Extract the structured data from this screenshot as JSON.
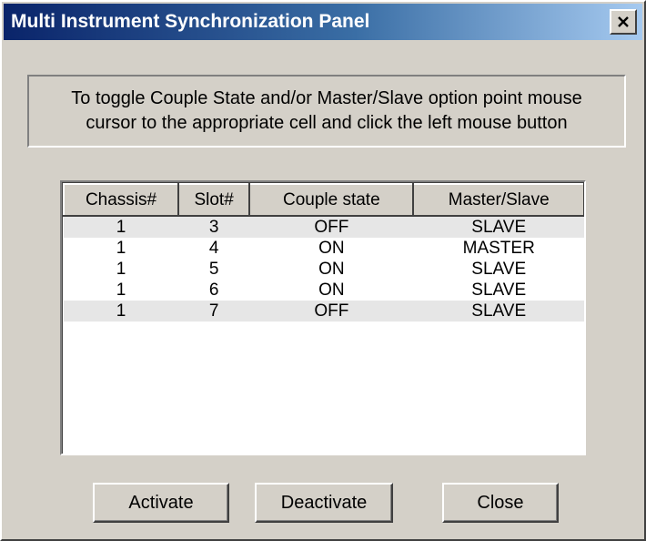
{
  "window": {
    "title": "Multi Instrument Synchronization Panel",
    "close_icon": "close-icon"
  },
  "instruction": {
    "line1": "To toggle Couple State and/or Master/Slave option point mouse",
    "line2": "cursor to the appropriate cell and click the left mouse button"
  },
  "table": {
    "columns": [
      "Chassis#",
      "Slot#",
      "Couple state",
      "Master/Slave"
    ],
    "rows": [
      {
        "chassis": "1",
        "slot": "3",
        "couple": "OFF",
        "role": "SLAVE"
      },
      {
        "chassis": "1",
        "slot": "4",
        "couple": "ON",
        "role": "MASTER"
      },
      {
        "chassis": "1",
        "slot": "5",
        "couple": "ON",
        "role": "SLAVE"
      },
      {
        "chassis": "1",
        "slot": "6",
        "couple": "ON",
        "role": "SLAVE"
      },
      {
        "chassis": "1",
        "slot": "7",
        "couple": "OFF",
        "role": "SLAVE"
      }
    ]
  },
  "buttons": {
    "activate": "Activate",
    "deactivate": "Deactivate",
    "close": "Close"
  },
  "colors": {
    "titlebar_start": "#0a246a",
    "titlebar_end": "#a6caf0",
    "face": "#d4d0c8"
  }
}
